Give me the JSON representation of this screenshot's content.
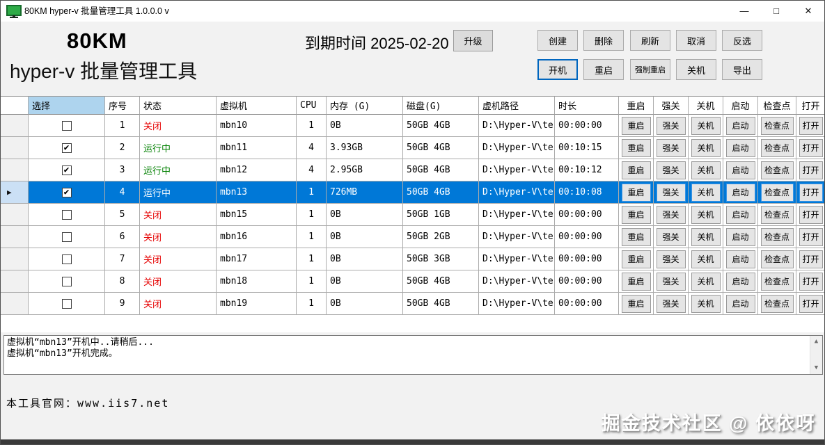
{
  "window": {
    "title": "80KM hyper-v 批量管理工具 1.0.0.0 v",
    "minimize": "—",
    "maximize": "□",
    "close": "✕"
  },
  "header": {
    "brand_line1": "80KM",
    "brand_line2": "hyper-v 批量管理工具",
    "expiry_text": "到期时间 2025-02-20",
    "upgrade_label": "升级",
    "buttons_row1": [
      "创建",
      "删除",
      "刷新",
      "取消",
      "反选"
    ],
    "buttons_row2": [
      "开机",
      "重启",
      "强制重启",
      "关机",
      "导出"
    ]
  },
  "table": {
    "columns": [
      "选择",
      "序号",
      "状态",
      "虚拟机",
      "CPU",
      "内存 (G)",
      "磁盘(G)",
      "虚机路径",
      "时长",
      "重启",
      "强关",
      "关机",
      "启动",
      "检查点",
      "打开"
    ],
    "action_labels": [
      "重启",
      "强关",
      "关机",
      "启动",
      "检查点",
      "打开"
    ],
    "rows": [
      {
        "checked": false,
        "index": "1",
        "status": "关闭",
        "status_color": "red",
        "vm": "mbn10",
        "cpu": "1",
        "mem": "0B",
        "disk": "50GB 4GB",
        "path": "D:\\Hyper-V\\tes...",
        "duration": "00:00:00",
        "selected": false
      },
      {
        "checked": true,
        "index": "2",
        "status": "运行中",
        "status_color": "green",
        "vm": "mbn11",
        "cpu": "4",
        "mem": "3.93GB",
        "disk": "50GB 4GB",
        "path": "D:\\Hyper-V\\tes...",
        "duration": "00:10:15",
        "selected": false
      },
      {
        "checked": true,
        "index": "3",
        "status": "运行中",
        "status_color": "green",
        "vm": "mbn12",
        "cpu": "4",
        "mem": "2.95GB",
        "disk": "50GB 4GB",
        "path": "D:\\Hyper-V\\tes...",
        "duration": "00:10:12",
        "selected": false
      },
      {
        "checked": true,
        "index": "4",
        "status": "运行中",
        "status_color": "green",
        "vm": "mbn13",
        "cpu": "1",
        "mem": "726MB",
        "disk": "50GB 4GB",
        "path": "D:\\Hyper-V\\tes...",
        "duration": "00:10:08",
        "selected": true
      },
      {
        "checked": false,
        "index": "5",
        "status": "关闭",
        "status_color": "red",
        "vm": "mbn15",
        "cpu": "1",
        "mem": "0B",
        "disk": "50GB 1GB",
        "path": "D:\\Hyper-V\\tes...",
        "duration": "00:00:00",
        "selected": false
      },
      {
        "checked": false,
        "index": "6",
        "status": "关闭",
        "status_color": "red",
        "vm": "mbn16",
        "cpu": "1",
        "mem": "0B",
        "disk": "50GB 2GB",
        "path": "D:\\Hyper-V\\tes...",
        "duration": "00:00:00",
        "selected": false
      },
      {
        "checked": false,
        "index": "7",
        "status": "关闭",
        "status_color": "red",
        "vm": "mbn17",
        "cpu": "1",
        "mem": "0B",
        "disk": "50GB 3GB",
        "path": "D:\\Hyper-V\\tes...",
        "duration": "00:00:00",
        "selected": false
      },
      {
        "checked": false,
        "index": "8",
        "status": "关闭",
        "status_color": "red",
        "vm": "mbn18",
        "cpu": "1",
        "mem": "0B",
        "disk": "50GB 4GB",
        "path": "D:\\Hyper-V\\tes...",
        "duration": "00:00:00",
        "selected": false
      },
      {
        "checked": false,
        "index": "9",
        "status": "关闭",
        "status_color": "red",
        "vm": "mbn19",
        "cpu": "1",
        "mem": "0B",
        "disk": "50GB 4GB",
        "path": "D:\\Hyper-V\\tes...",
        "duration": "00:00:00",
        "selected": false
      }
    ]
  },
  "log": {
    "lines": [
      "虚拟机“mbn13”开机中..请稍后...",
      "虚拟机“mbn13”开机完成。"
    ]
  },
  "footer": {
    "site_text": "本工具官网：www.iis7.net"
  },
  "watermark_text": "掘金技术社区 @ 依依呀",
  "colors": {
    "selection_blue": "#0078d7",
    "status_off_red": "#e60000",
    "status_running_green": "#008000",
    "select_header_blue": "#aed4ee",
    "focused_button_border": "#0066bf"
  }
}
